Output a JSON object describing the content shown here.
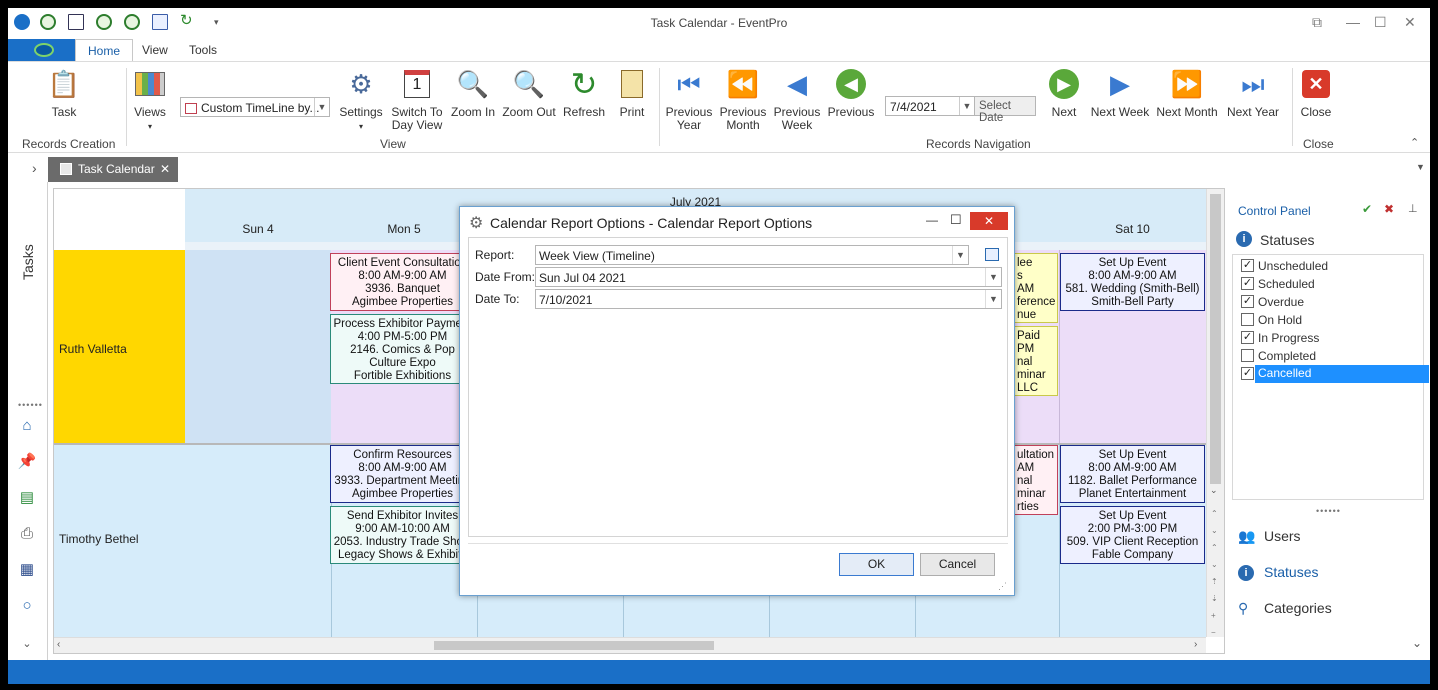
{
  "window": {
    "title": "Task Calendar - EventPro"
  },
  "ribbon_tabs": [
    "Home",
    "View",
    "Tools"
  ],
  "ribbon": {
    "task": "Task",
    "records_creation": "Records Creation",
    "views": "Views",
    "custom_timeline": "Custom TimeLine by...",
    "settings": "Settings",
    "switch_day_1": "Switch To",
    "switch_day_2": "Day View",
    "zoom_in": "Zoom In",
    "zoom_out": "Zoom Out",
    "refresh": "Refresh",
    "print": "Print",
    "view_group": "View",
    "prev_year_1": "Previous",
    "prev_year_2": "Year",
    "prev_month_1": "Previous",
    "prev_month_2": "Month",
    "prev_week_1": "Previous",
    "prev_week_2": "Week",
    "previous": "Previous",
    "date_value": "7/4/2021",
    "select_date": "Select Date",
    "next": "Next",
    "next_week": "Next Week",
    "next_month": "Next Month",
    "next_year": "Next Year",
    "records_navigation": "Records Navigation",
    "close": "Close",
    "close_group": "Close"
  },
  "doc_tab": {
    "label": "Task Calendar"
  },
  "left_rail": {
    "label": "Tasks"
  },
  "scheduler": {
    "month": "July 2021",
    "days": [
      "Sun 4",
      "Mon 5",
      "",
      "",
      "",
      "Sat 10"
    ],
    "resources": [
      "Ruth Valletta",
      "Timothy Bethel"
    ],
    "appts": [
      {
        "lines": [
          "Client Event Consultation",
          "8:00 AM-9:00 AM",
          "3936. Banquet",
          "Agimbee Properties"
        ]
      },
      {
        "lines": [
          "Process Exhibitor Payment",
          "4:00 PM-5:00 PM",
          "2146. Comics & Pop",
          "Culture Expo",
          "Fortible Exhibitions"
        ]
      },
      {
        "lines": [
          "Confirm Resources",
          "8:00 AM-9:00 AM",
          "3933. Department Meeting",
          "Agimbee Properties"
        ]
      },
      {
        "lines": [
          "Send Exhibitor Invites",
          "9:00 AM-10:00 AM",
          "2053. Industry Trade Show",
          "Legacy Shows & Exhibits"
        ]
      },
      {
        "lines": [
          "Set Up Event",
          "8:00 AM-9:00 AM",
          "581. Wedding (Smith-Bell)",
          "Smith-Bell Party"
        ]
      },
      {
        "lines": [
          "Set Up Event",
          "8:00 AM-9:00 AM",
          "1182. Ballet Performance",
          "Planet Entertainment"
        ]
      },
      {
        "lines": [
          "Set Up Event",
          "2:00 PM-3:00 PM",
          "509. VIP Client Reception",
          "Fable Company"
        ]
      },
      {
        "lines": [
          "lee",
          "s",
          "AM",
          "ference",
          "nue"
        ]
      },
      {
        "lines": [
          "Paid",
          "PM",
          "nal",
          "minar",
          "LLC"
        ]
      },
      {
        "lines": [
          "ultation",
          "AM",
          "nal",
          "minar",
          "rties"
        ]
      }
    ]
  },
  "control_panel": {
    "title": "Control Panel",
    "statuses_header": "Statuses",
    "statuses": [
      {
        "label": "Unscheduled",
        "checked": true
      },
      {
        "label": "Scheduled",
        "checked": true
      },
      {
        "label": "Overdue",
        "checked": true
      },
      {
        "label": "On Hold",
        "checked": false
      },
      {
        "label": "In Progress",
        "checked": true
      },
      {
        "label": "Completed",
        "checked": false
      },
      {
        "label": "Cancelled",
        "checked": true
      }
    ],
    "nav": [
      "Users",
      "Statuses",
      "Categories"
    ]
  },
  "dialog": {
    "title": "Calendar Report Options - Calendar Report Options",
    "report_label": "Report:",
    "report_value": "Week View (Timeline)",
    "date_from_label": "Date From:",
    "date_from_value": "Sun Jul 04 2021",
    "date_to_label": "Date To:",
    "date_to_value": "7/10/2021",
    "ok": "OK",
    "cancel": "Cancel"
  }
}
